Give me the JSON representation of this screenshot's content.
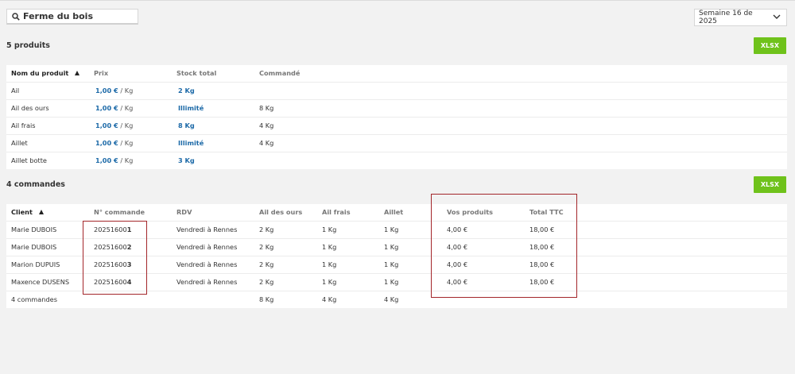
{
  "search": {
    "value": "Ferme du bois"
  },
  "week_selector": {
    "label": "Semaine 16 de 2025"
  },
  "products": {
    "count_label": "5 produits",
    "xlsx_label": "XLSX",
    "headers": [
      "Nom du produit",
      "Prix",
      "Stock total",
      "Commandé"
    ],
    "rows": [
      {
        "name": "Ail",
        "price": "1,00 €",
        "unit": "/ Kg",
        "stock": "2 Kg",
        "ordered": ""
      },
      {
        "name": "Ail des ours",
        "price": "1,00 €",
        "unit": "/ Kg",
        "stock": "Illimité",
        "ordered": "8 Kg"
      },
      {
        "name": "Ail frais",
        "price": "1,00 €",
        "unit": "/ Kg",
        "stock": "8 Kg",
        "ordered": "4 Kg"
      },
      {
        "name": "Aillet",
        "price": "1,00 €",
        "unit": "/ Kg",
        "stock": "Illimité",
        "ordered": "4 Kg"
      },
      {
        "name": "Aillet botte",
        "price": "1,00 €",
        "unit": "/ Kg",
        "stock": "3 Kg",
        "ordered": ""
      }
    ]
  },
  "orders": {
    "count_label": "4 commandes",
    "xlsx_label": "XLSX",
    "headers": [
      "Client",
      "N° commande",
      "RDV",
      "Ail des ours",
      "Ail frais",
      "Aillet",
      "Vos produits",
      "Total TTC"
    ],
    "rows": [
      {
        "client": "Marie DUBOIS",
        "num_prefix": "20251600",
        "num_suffix": "1",
        "rdv": "Vendredi à Rennes",
        "ail_ours": "2 Kg",
        "ail_frais": "1 Kg",
        "aillet": "1 Kg",
        "vos_produits": "4,00 €",
        "total": "18,00 €"
      },
      {
        "client": "Marie DUBOIS",
        "num_prefix": "20251600",
        "num_suffix": "2",
        "rdv": "Vendredi à Rennes",
        "ail_ours": "2 Kg",
        "ail_frais": "1 Kg",
        "aillet": "1 Kg",
        "vos_produits": "4,00 €",
        "total": "18,00 €"
      },
      {
        "client": "Marion DUPUIS",
        "num_prefix": "20251600",
        "num_suffix": "3",
        "rdv": "Vendredi à Rennes",
        "ail_ours": "2 Kg",
        "ail_frais": "1 Kg",
        "aillet": "1 Kg",
        "vos_produits": "4,00 €",
        "total": "18,00 €"
      },
      {
        "client": "Maxence DUSENS",
        "num_prefix": "20251600",
        "num_suffix": "4",
        "rdv": "Vendredi à Rennes",
        "ail_ours": "2 Kg",
        "ail_frais": "1 Kg",
        "aillet": "1 Kg",
        "vos_produits": "4,00 €",
        "total": "18,00 €"
      }
    ],
    "totals": {
      "label": "4 commandes",
      "ail_ours": "8 Kg",
      "ail_frais": "4 Kg",
      "aillet": "4 Kg"
    }
  },
  "colors": {
    "accent_green": "#6fc21b",
    "price_blue": "#1d6aa8",
    "highlight_red": "#a3262a"
  }
}
